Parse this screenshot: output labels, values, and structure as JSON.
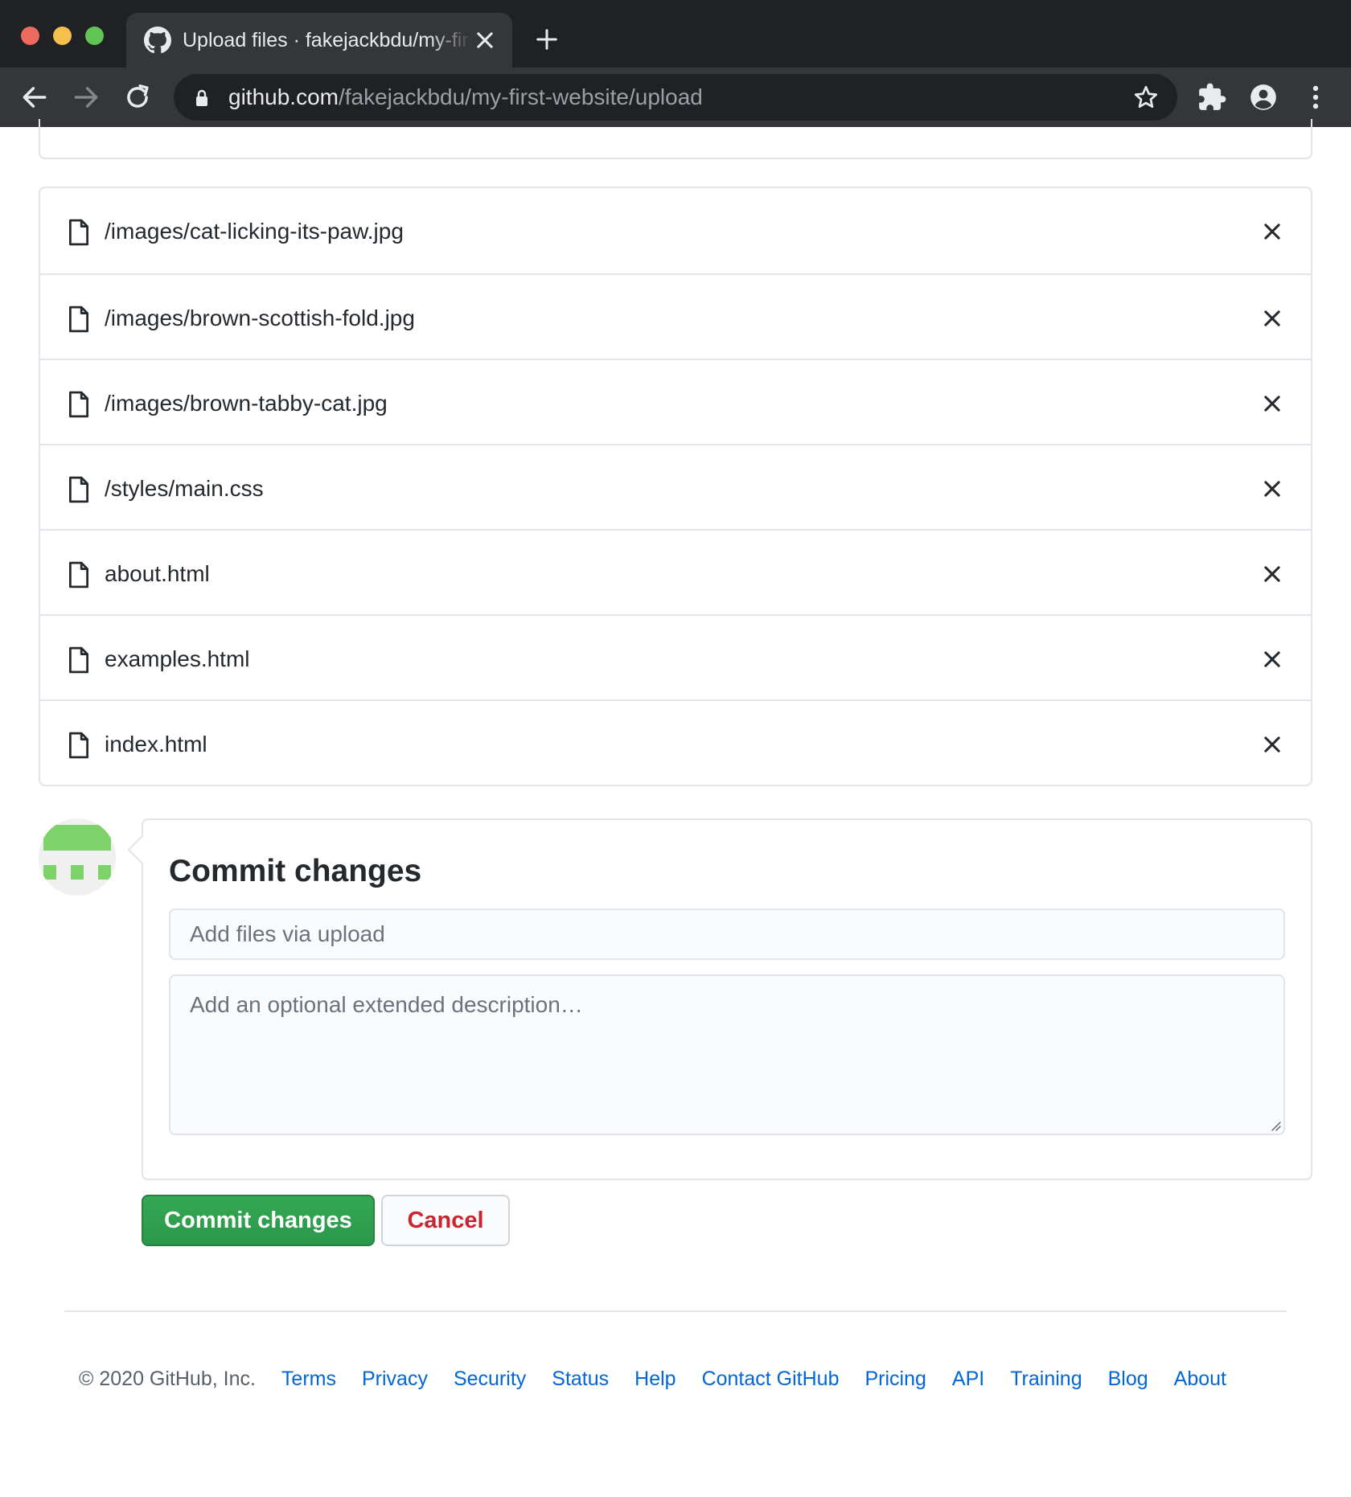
{
  "browser": {
    "tab_title": "Upload files · fakejackbdu/my-first-website",
    "url_host": "github.com",
    "url_path": "/fakejackbdu/my-first-website/upload"
  },
  "files": [
    {
      "name": "/images/cat-licking-its-paw.jpg"
    },
    {
      "name": "/images/brown-scottish-fold.jpg"
    },
    {
      "name": "/images/brown-tabby-cat.jpg"
    },
    {
      "name": "/styles/main.css"
    },
    {
      "name": "about.html"
    },
    {
      "name": "examples.html"
    },
    {
      "name": "index.html"
    }
  ],
  "commit": {
    "title": "Commit changes",
    "summary_placeholder": "Add files via upload",
    "description_placeholder": "Add an optional extended description…",
    "commit_button": "Commit changes",
    "cancel_button": "Cancel"
  },
  "footer": {
    "copyright": "© 2020 GitHub, Inc.",
    "links": [
      "Terms",
      "Privacy",
      "Security",
      "Status",
      "Help",
      "Contact GitHub",
      "Pricing",
      "API",
      "Training",
      "Blog",
      "About"
    ]
  },
  "colors": {
    "chrome_dark": "#202124",
    "chrome_tab": "#35363a",
    "commit_green": "#2c974b",
    "cancel_red": "#cb2431",
    "link_blue": "#0366d6",
    "identicon_green": "#7dd36a"
  },
  "icons": {
    "tab_favicon": "github-icon",
    "file": "file-icon",
    "remove": "close-icon"
  }
}
